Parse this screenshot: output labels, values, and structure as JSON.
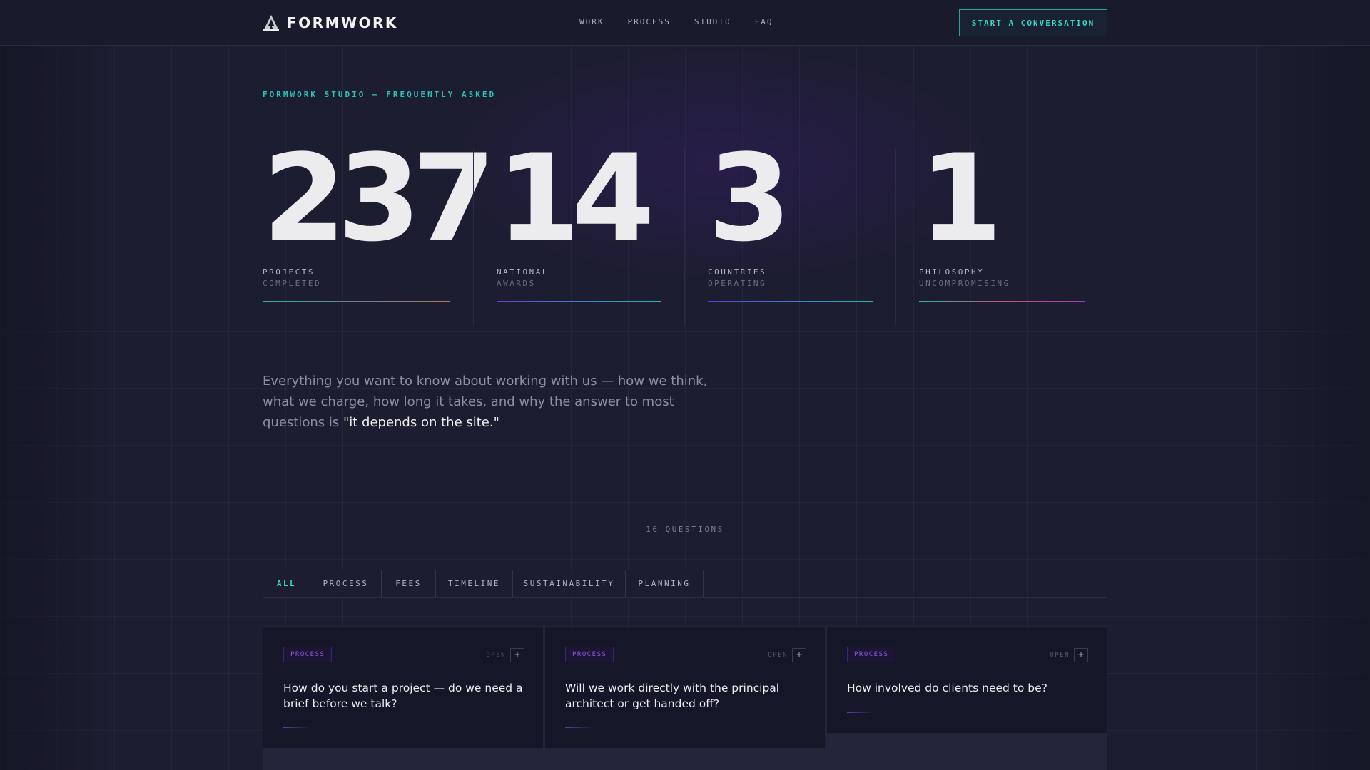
{
  "brand": {
    "name": "FORMWORK",
    "logo_icon": "a-frame-logo-icon"
  },
  "nav": {
    "links": [
      "WORK",
      "PROCESS",
      "STUDIO",
      "FAQ"
    ],
    "cta": "START A CONVERSATION"
  },
  "hero": {
    "eyebrow": "FORMWORK STUDIO — FREQUENTLY ASKED",
    "stats": [
      {
        "value": "237",
        "label_1": "PROJECTS",
        "label_2": "COMPLETED"
      },
      {
        "value": "14",
        "label_1": "NATIONAL",
        "label_2": "AWARDS"
      },
      {
        "value": "3",
        "label_1": "COUNTRIES",
        "label_2": "OPERATING"
      },
      {
        "value": "1",
        "label_1": "PHILOSOPHY",
        "label_2": "UNCOMPROMISING"
      }
    ],
    "intro_text": "Everything you want to know about working with us — how we think, what we charge, how long it takes, and why the answer to most questions is ",
    "intro_highlight": "\"it depends on the site.\""
  },
  "faq": {
    "count_label": "16 QUESTIONS",
    "filters": [
      "ALL",
      "PROCESS",
      "FEES",
      "TIMELINE",
      "SUSTAINABILITY",
      "PLANNING"
    ],
    "active_filter": "ALL",
    "cards": [
      {
        "tag": "PROCESS",
        "open_label": "OPEN",
        "question": "How do you start a project — do we need a brief before we talk?"
      },
      {
        "tag": "PROCESS",
        "open_label": "OPEN",
        "question": "Will we work directly with the principal architect or get handed off?"
      },
      {
        "tag": "PROCESS",
        "open_label": "OPEN",
        "question": "How involved do clients need to be?"
      }
    ]
  },
  "colors": {
    "background": "#1c1d30",
    "accent_teal": "#2dc2b2",
    "accent_purple": "#8c5ce0",
    "card_background": "#151628"
  }
}
